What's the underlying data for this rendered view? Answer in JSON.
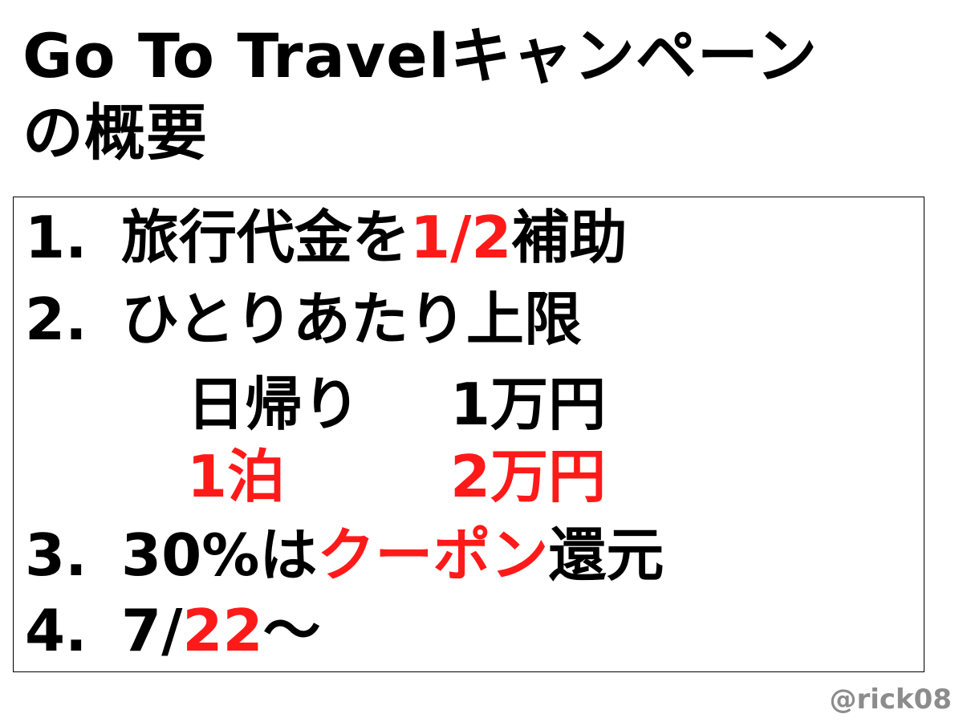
{
  "title": {
    "line1": "Go To Travelキャンペーン",
    "line2": "の概要"
  },
  "items": [
    {
      "number": "1.",
      "parts": [
        {
          "text": "旅行代金を",
          "highlight": false
        },
        {
          "text": "1/2",
          "highlight": true
        },
        {
          "text": "補助",
          "highlight": false
        }
      ]
    },
    {
      "number": "2.",
      "parts": [
        {
          "text": "ひとりあたり上限",
          "highlight": false
        }
      ],
      "limits": [
        {
          "label": "日帰り",
          "amount": "1万円",
          "highlight": false
        },
        {
          "label": "1泊",
          "amount": "2万円",
          "highlight": true
        }
      ]
    },
    {
      "number": "3.",
      "parts": [
        {
          "text": "30%は",
          "highlight": false
        },
        {
          "text": "クーポン",
          "highlight": true
        },
        {
          "text": "還元",
          "highlight": false
        }
      ]
    },
    {
      "number": "4.",
      "parts": [
        {
          "text": "7/",
          "highlight": false
        },
        {
          "text": "22",
          "highlight": true
        },
        {
          "text": "〜",
          "highlight": false
        }
      ]
    }
  ],
  "watermark": "@rick08",
  "colors": {
    "text": "#000000",
    "highlight": "#ff1a1a",
    "watermark": "#8c8c8c",
    "border": "#000000"
  }
}
